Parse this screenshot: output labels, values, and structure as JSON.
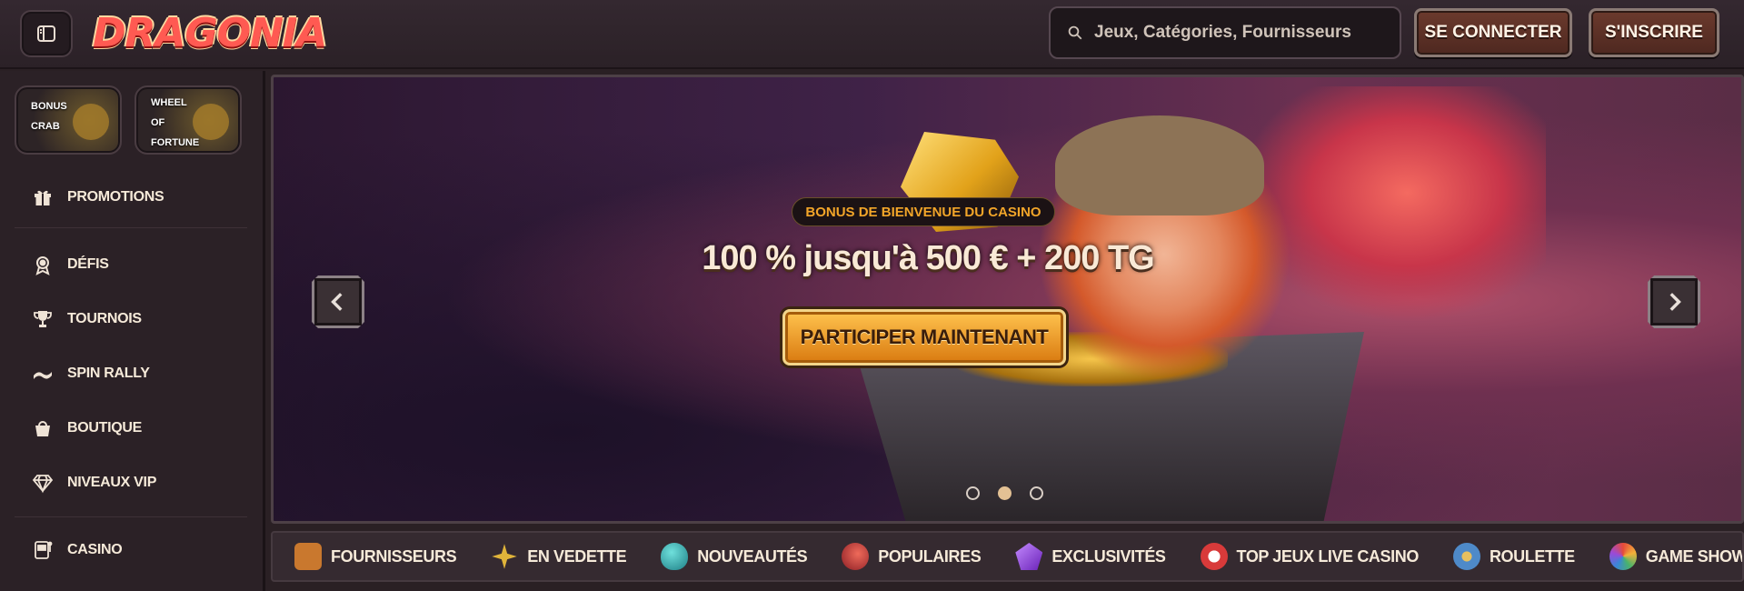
{
  "header": {
    "logo_text": "DRAGONIA",
    "search_placeholder": "Jeux, Catégories, Fournisseurs",
    "login_label": "SE CONNECTER",
    "signup_label": "S'INSCRIRE"
  },
  "sidebar": {
    "quick_links": [
      {
        "label_lines": [
          "BONUS",
          "CRAB"
        ]
      },
      {
        "label_lines": [
          "WHEEL",
          "OF",
          "FORTUNE"
        ]
      }
    ],
    "items": [
      {
        "label": "PROMOTIONS",
        "icon": "gift-icon"
      },
      {
        "label": "DÉFIS",
        "icon": "medal-icon"
      },
      {
        "label": "TOURNOIS",
        "icon": "trophy-icon"
      },
      {
        "label": "SPIN RALLY",
        "icon": "race-flag-icon"
      },
      {
        "label": "BOUTIQUE",
        "icon": "shopping-bag-icon"
      },
      {
        "label": "NIVEAUX VIP",
        "icon": "diamond-icon"
      },
      {
        "label": "CASINO",
        "icon": "slot-machine-icon"
      }
    ]
  },
  "hero": {
    "badge": "BONUS DE BIENVENUE DU CASINO",
    "headline": "100 % jusqu'à 500 € + 200 TG",
    "cta_label": "PARTICIPER MAINTENANT",
    "slide_count": 3,
    "active_slide": 2
  },
  "categories": [
    {
      "label": "FOURNISSEURS",
      "icon": "treasure-chest-icon",
      "color": "#c9782e"
    },
    {
      "label": "EN VEDETTE",
      "icon": "star-icon",
      "color": "#e0b43a"
    },
    {
      "label": "NOUVEAUTÉS",
      "icon": "egg-icon",
      "color": "#2aa6a6"
    },
    {
      "label": "POPULAIRES",
      "icon": "rocket-icon",
      "color": "#c93a3a"
    },
    {
      "label": "EXCLUSIVITÉS",
      "icon": "gem-icon",
      "color": "#8a3bd6"
    },
    {
      "label": "TOP JEUX LIVE CASINO",
      "icon": "poker-chip-icon",
      "color": "#d83a3a"
    },
    {
      "label": "ROULETTE",
      "icon": "roulette-icon",
      "color": "#4e8ac9"
    },
    {
      "label": "GAME SHOWS",
      "icon": "wheel-icon",
      "color": "#d8742a"
    }
  ]
}
